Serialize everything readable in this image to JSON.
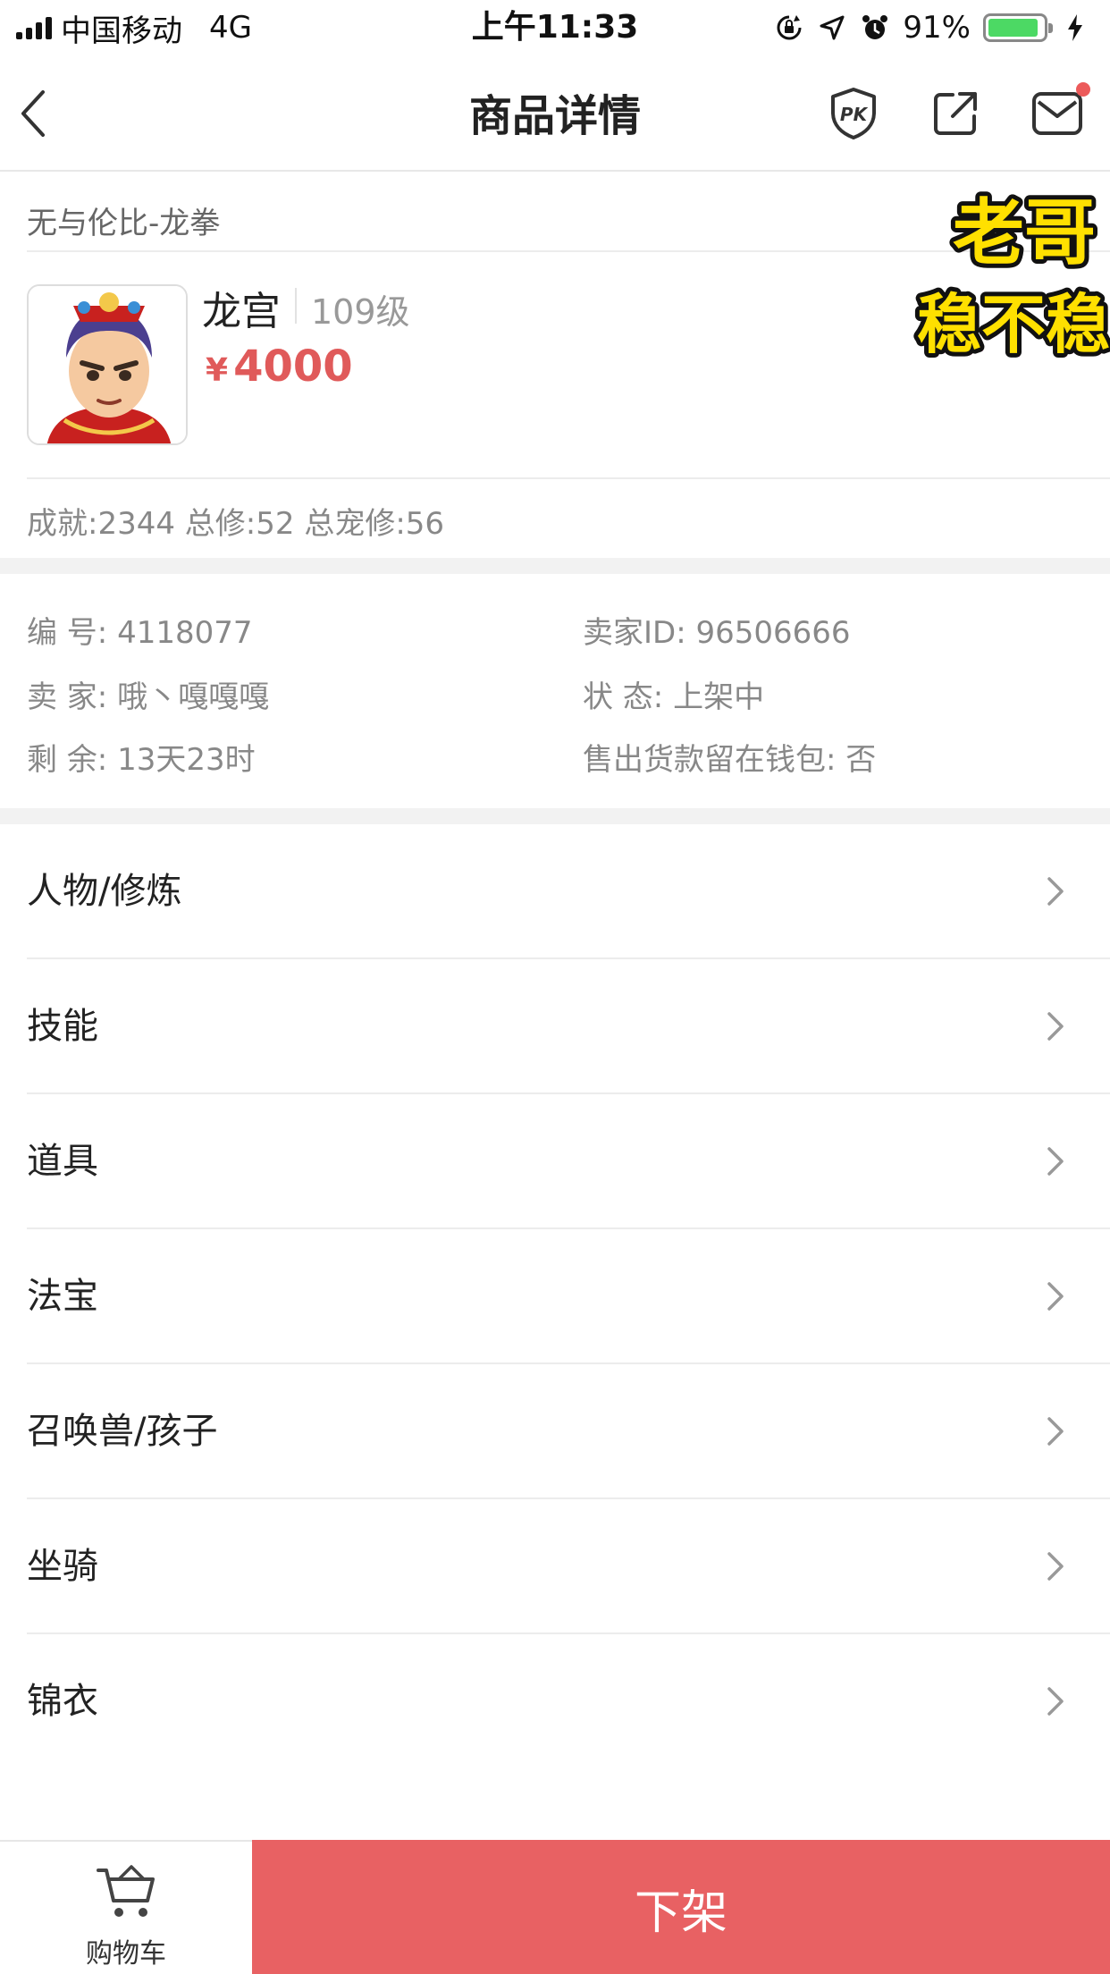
{
  "status_bar": {
    "carrier": "中国移动",
    "network": "4G",
    "time": "上午11:33",
    "battery_percent": "91%",
    "battery_level": 0.91
  },
  "nav": {
    "title": "商品详情",
    "icons": [
      "back-icon",
      "pk-shield-icon",
      "share-icon",
      "mail-icon"
    ]
  },
  "product": {
    "server": "无与伦比-龙拳",
    "character_name": "龙宫",
    "level": "109级",
    "currency": "¥",
    "price": "4000",
    "stats": "成就:2344 总修:52 总宠修:56",
    "sticker_text": "老哥 稳不稳"
  },
  "info": {
    "id_label": "编 号:",
    "id_value": "4118077",
    "seller_id_label": "卖家ID:",
    "seller_id_value": "96506666",
    "seller_label": "卖 家:",
    "seller_value": "哦丶嘎嘎嘎",
    "status_label": "状 态:",
    "status_value": "上架中",
    "remaining_label": "剩 余:",
    "remaining_value": "13天23时",
    "wallet_label": "售出货款留在钱包:",
    "wallet_value": "否"
  },
  "menu": [
    {
      "label": "人物/修炼"
    },
    {
      "label": "技能"
    },
    {
      "label": "道具"
    },
    {
      "label": "法宝"
    },
    {
      "label": "召唤兽/孩子"
    },
    {
      "label": "坐骑"
    },
    {
      "label": "锦衣"
    }
  ],
  "bottom": {
    "cart_label": "购物车",
    "delist_label": "下架"
  },
  "colors": {
    "accent_red": "#e86163",
    "price_red": "#e05a5a",
    "battery_green": "#4cd964"
  }
}
